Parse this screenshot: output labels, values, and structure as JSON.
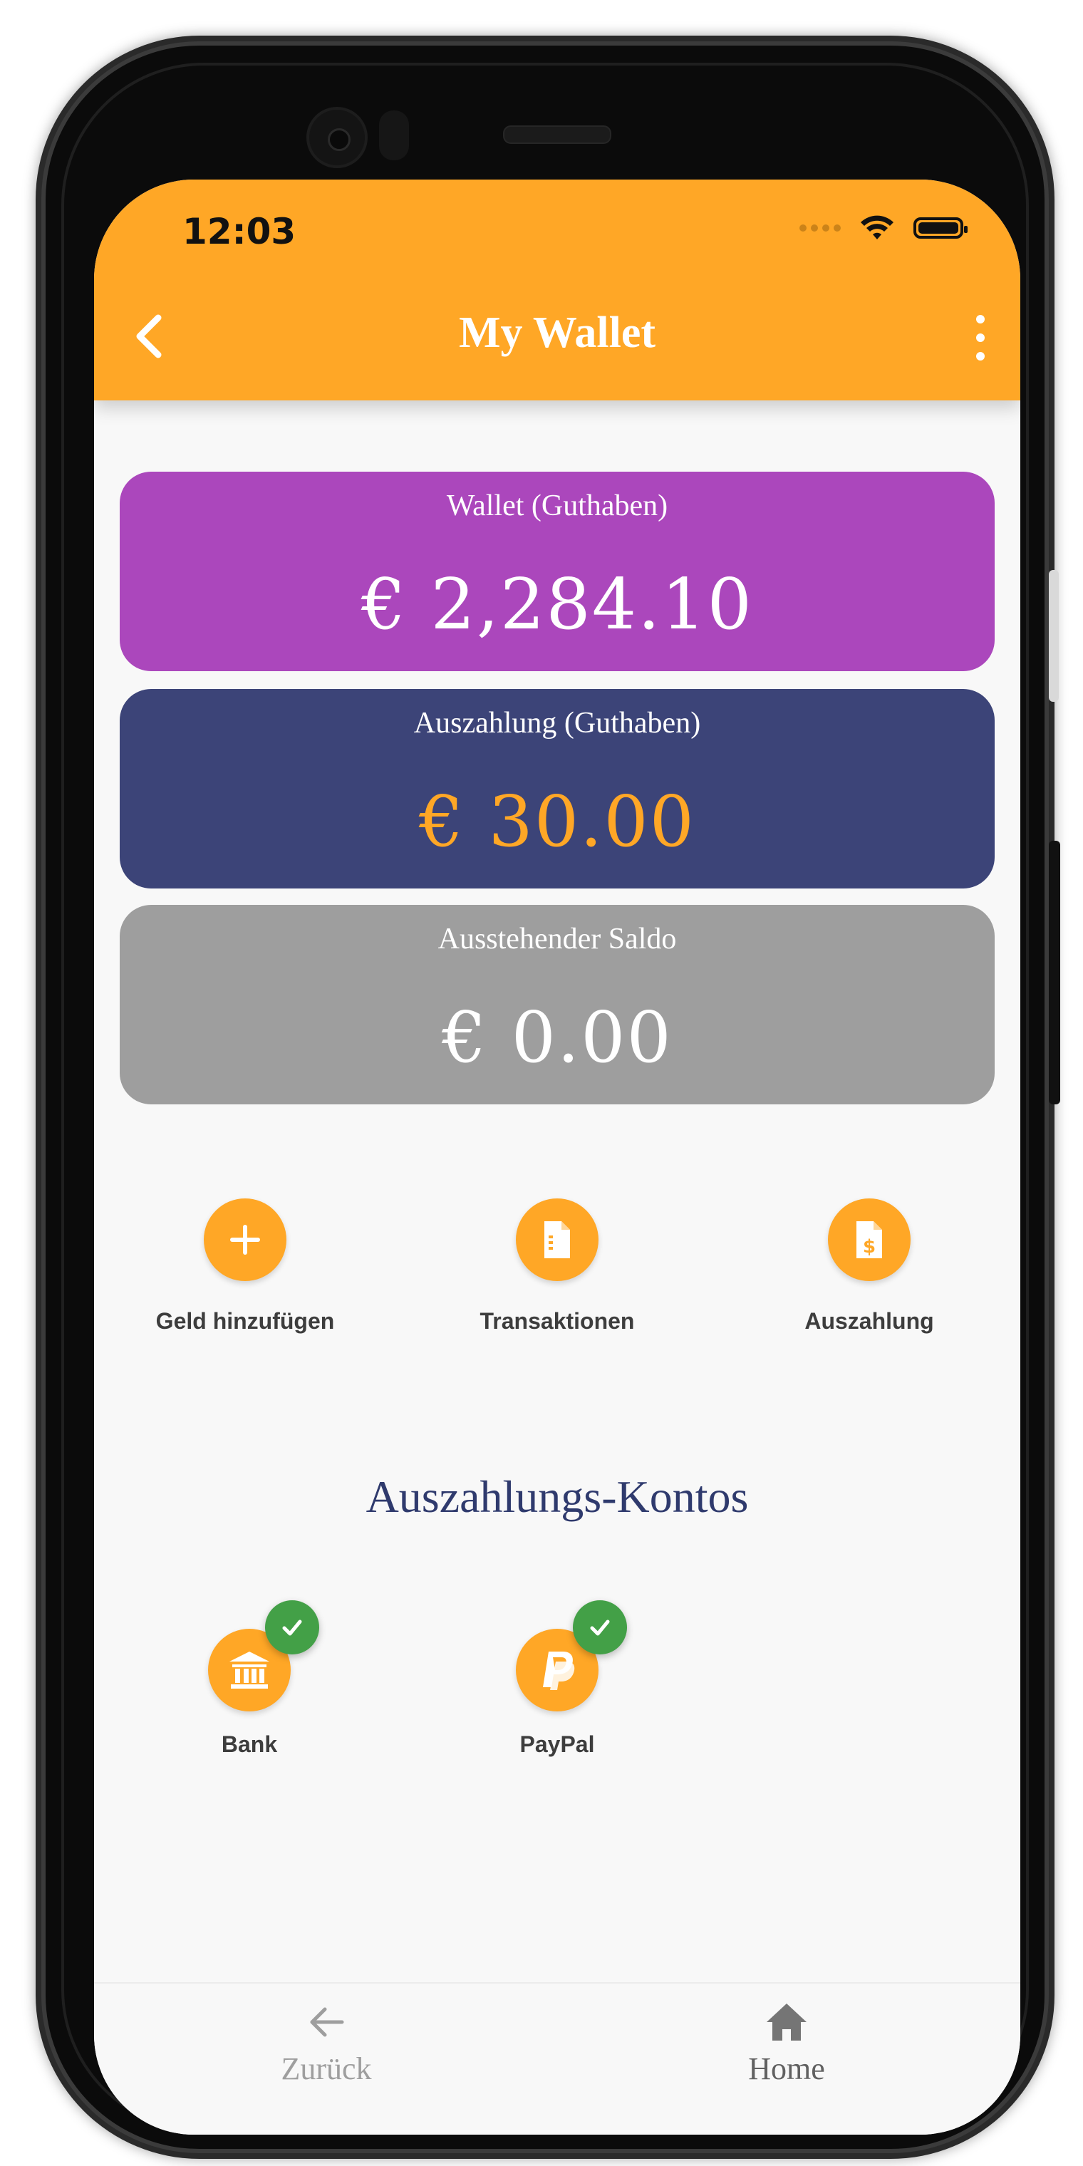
{
  "status_bar": {
    "time": "12:03"
  },
  "header": {
    "title": "My Wallet",
    "back_icon": "chevron-left-icon",
    "menu_icon": "more-vertical-icon"
  },
  "cards": {
    "wallet": {
      "label": "Wallet (Guthaben)",
      "value": "€ 2,284.10",
      "color": "#ab47bc"
    },
    "payout": {
      "label": "Auszahlung (Guthaben)",
      "value": "€ 30.00",
      "color": "#3c4478",
      "value_color": "#ffa726"
    },
    "pending": {
      "label": "Ausstehender Saldo",
      "value": "€ 0.00",
      "color": "#9e9e9e"
    }
  },
  "actions": [
    {
      "label": "Geld hinzufügen",
      "icon": "plus-icon"
    },
    {
      "label": "Transaktionen",
      "icon": "document-icon"
    },
    {
      "label": "Auszahlung",
      "icon": "invoice-dollar-icon"
    }
  ],
  "payout_accounts": {
    "title": "Auszahlungs-Kontos",
    "items": [
      {
        "label": "Bank",
        "icon": "bank-icon",
        "verified": true
      },
      {
        "label": "PayPal",
        "icon": "paypal-icon",
        "verified": true
      }
    ]
  },
  "bottom_nav": {
    "back": {
      "label": "Zurück",
      "icon": "arrow-left-icon"
    },
    "home": {
      "label": "Home",
      "icon": "home-icon"
    }
  },
  "colors": {
    "accent": "#ffa726",
    "success": "#43a047",
    "section_title": "#2f3a6d"
  }
}
